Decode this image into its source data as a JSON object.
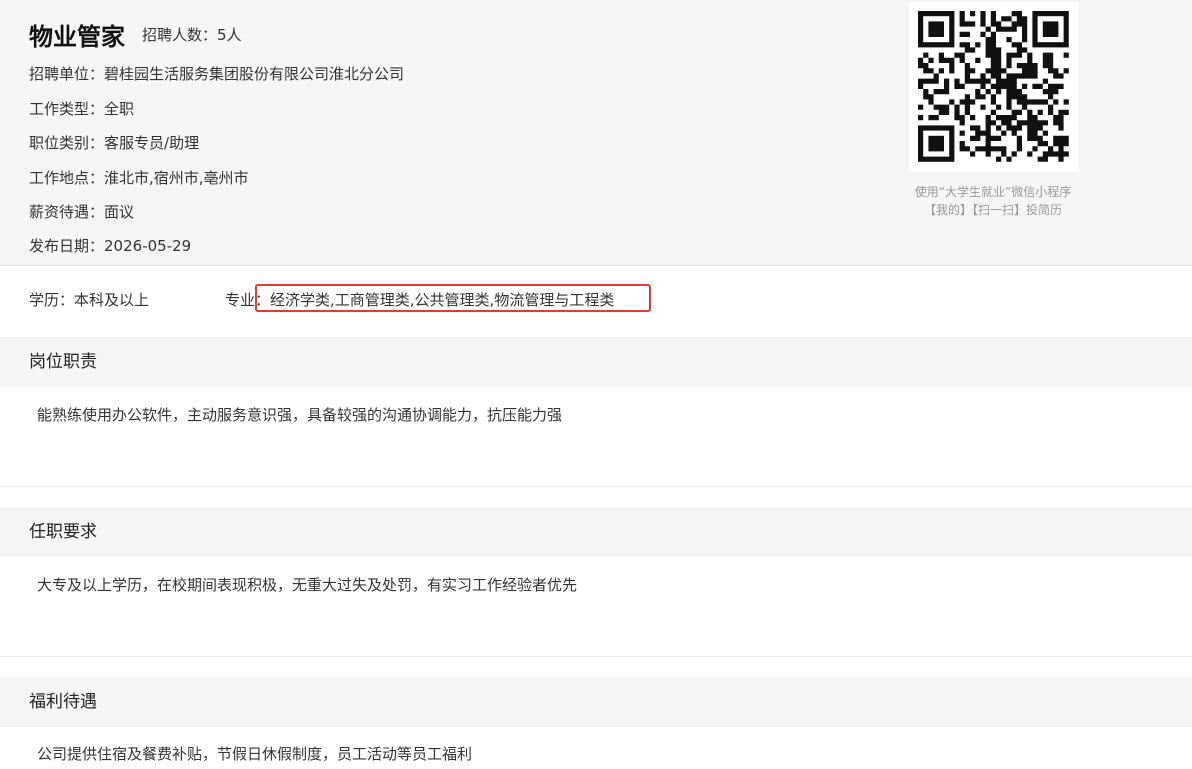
{
  "job": {
    "title": "物业管家",
    "headcount": "招聘人数：5人",
    "fields": [
      {
        "label": "招聘单位：",
        "value": "碧桂园生活服务集团股份有限公司淮北分公司"
      },
      {
        "label": "工作类型：",
        "value": "全职"
      },
      {
        "label": "职位类别：",
        "value": "客服专员/助理"
      },
      {
        "label": "工作地点：",
        "value": "淮北市,宿州市,亳州市"
      },
      {
        "label": "薪资待遇：",
        "value": "面议"
      },
      {
        "label": "发布日期：",
        "value": "2026-05-29"
      }
    ]
  },
  "qr": {
    "caption_line1": "使用“大学生就业”微信小程序",
    "caption_line2": "【我的】【扫一扫】投简历"
  },
  "requirements": {
    "education_label": "学历：",
    "education_value": "本科及以上",
    "major_label": "专业：",
    "major_value": "经济学类,工商管理类,公共管理类,物流管理与工程类",
    "highlight_color": "#e53935"
  },
  "sections": [
    {
      "title": "岗位职责",
      "body": "能熟练使用办公软件，主动服务意识强，具备较强的沟通协调能力，抗压能力强"
    },
    {
      "title": "任职要求",
      "body": "大专及以上学历，在校期间表现积极，无重大过失及处罚，有实习工作经验者优先"
    },
    {
      "title": "福利待遇",
      "body": "公司提供住宿及餐费补贴，节假日休假制度，员工活动等员工福利"
    }
  ]
}
